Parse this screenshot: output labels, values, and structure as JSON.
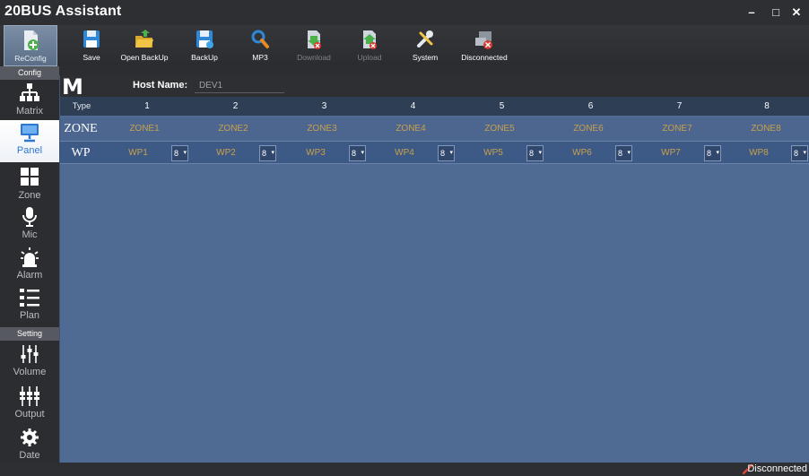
{
  "app": {
    "title": "20BUS Assistant"
  },
  "window_controls": {
    "minimize": "–",
    "maximize": "□",
    "close": "✕"
  },
  "toolbar": {
    "reconfig": "ReConfig",
    "save": "Save",
    "open_backup": "Open BackUp",
    "backup": "BackUp",
    "mp3": "MP3",
    "download": "Download",
    "upload": "Upload",
    "system": "System",
    "disconnected": "Disconnected"
  },
  "sidebar": {
    "config_section": "Config",
    "setting_section": "Setting",
    "items": [
      {
        "label": "Matrix",
        "icon": "matrix-icon"
      },
      {
        "label": "Panel",
        "icon": "panel-icon",
        "active": true
      },
      {
        "label": "Zone",
        "icon": "zone-icon"
      },
      {
        "label": "Mic",
        "icon": "mic-icon"
      },
      {
        "label": "Alarm",
        "icon": "alarm-icon"
      },
      {
        "label": "Plan",
        "icon": "plan-icon"
      },
      {
        "label": "Volume",
        "icon": "volume-icon"
      },
      {
        "label": "Output",
        "icon": "output-icon"
      },
      {
        "label": "Date",
        "icon": "date-icon"
      }
    ]
  },
  "main": {
    "logo": "M",
    "host_label": "Host Name:",
    "host_value": "DEV1",
    "type_header": "Type",
    "columns": [
      "1",
      "2",
      "3",
      "4",
      "5",
      "6",
      "7",
      "8"
    ],
    "rows": {
      "zone": {
        "label": "ZONE",
        "cells": [
          "ZONE1",
          "ZONE2",
          "ZONE3",
          "ZONE4",
          "ZONE5",
          "ZONE6",
          "ZONE7",
          "ZONE8"
        ]
      },
      "wp": {
        "label": "WP",
        "cells": [
          "WP1",
          "WP2",
          "WP3",
          "WP4",
          "WP5",
          "WP6",
          "WP7",
          "WP8"
        ],
        "selects": [
          "8",
          "8",
          "8",
          "8",
          "8",
          "8",
          "8",
          "8"
        ]
      }
    }
  },
  "status": {
    "text": "Disconnected"
  },
  "colors": {
    "accent": "#2d77d3",
    "cell_text": "#c8a04a",
    "grid_bg": "#4f6a93"
  }
}
